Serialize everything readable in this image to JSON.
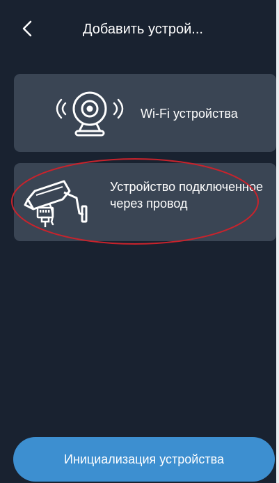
{
  "header": {
    "back_icon": "chevron-left-icon",
    "title": "Добавить устрой..."
  },
  "cards": [
    {
      "icon": "wifi-camera-icon",
      "label": "Wi-Fi устройства"
    },
    {
      "icon": "wired-camera-icon",
      "label": "Устройство подключенное через провод",
      "highlighted": true
    }
  ],
  "footer": {
    "init_label": "Инициализация устройства"
  },
  "colors": {
    "background": "#192230",
    "card": "#3a4554",
    "button": "#3d8fd0",
    "highlight": "#c8232c",
    "text": "#ffffff"
  }
}
